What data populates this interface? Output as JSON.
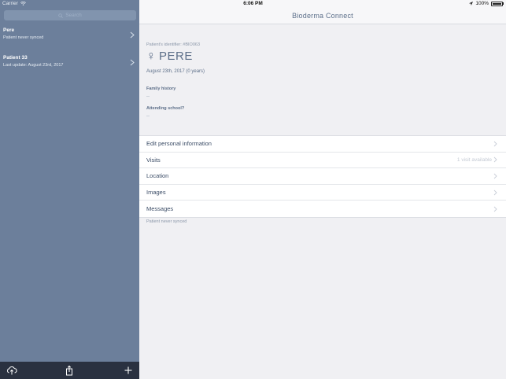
{
  "statusbar": {
    "carrier": "Carrier",
    "time": "6:06 PM",
    "battery": "100%"
  },
  "sidebar": {
    "search_placeholder": "Search",
    "patients": [
      {
        "name": "Pere",
        "subtitle": "Patient never synced"
      },
      {
        "name": "Patient 33",
        "subtitle": "Last update: August 23rd, 2017"
      }
    ],
    "toolbar": {
      "icons": [
        "cloud-upload-icon",
        "share-icon",
        "add-icon"
      ]
    }
  },
  "main": {
    "title": "Bioderma Connect",
    "patient": {
      "identifier": "Patient's identifier: #BIO063",
      "gender_symbol": "♀",
      "name": "PERE",
      "dob": "August 23th, 2017 (0 years)",
      "family_history_label": "Family history",
      "family_history_value": "--",
      "attending_school_label": "Attending school?",
      "attending_school_value": "--"
    },
    "menu": [
      {
        "label": "Edit personal information",
        "detail": ""
      },
      {
        "label": "Visits",
        "detail": "1 visit available"
      },
      {
        "label": "Location",
        "detail": ""
      },
      {
        "label": "Images",
        "detail": ""
      },
      {
        "label": "Messages",
        "detail": ""
      }
    ],
    "footer_note": "Patient never synced"
  },
  "colors": {
    "sidebar_bg": "#6c7f9b",
    "toolbar_bg": "#2a3140",
    "accent": "#5d6f89"
  }
}
